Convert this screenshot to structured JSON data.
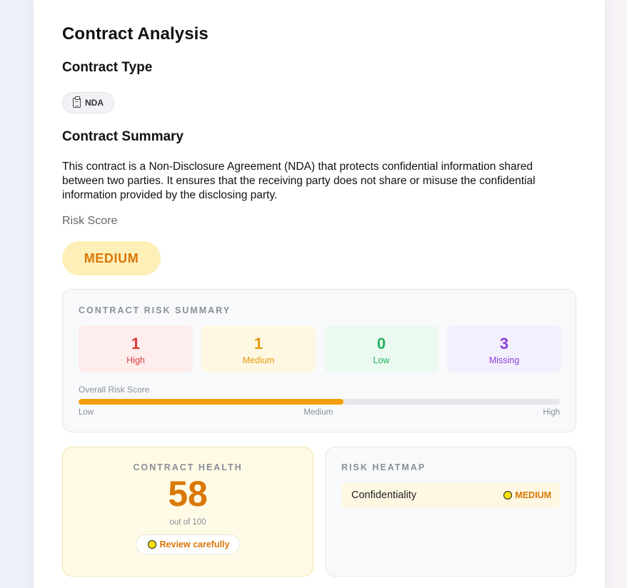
{
  "page": {
    "title": "Contract Analysis",
    "contract_type_heading": "Contract Type",
    "contract_type": "NDA",
    "summary_heading": "Contract Summary",
    "summary": "This contract is a Non-Disclosure Agreement (NDA) that protects confidential information shared between two parties. It ensures that the receiving party does not share or misuse the confidential information provided by the disclosing party.",
    "risk_score_label": "Risk Score",
    "risk_score": "MEDIUM"
  },
  "risk_summary": {
    "caption": "CONTRACT RISK SUMMARY",
    "stats": [
      {
        "value": "1",
        "label": "High"
      },
      {
        "value": "1",
        "label": "Medium"
      },
      {
        "value": "0",
        "label": "Low"
      },
      {
        "value": "3",
        "label": "Missing"
      }
    ],
    "overall_label": "Overall Risk Score",
    "overall_fraction": 0.55,
    "scale": [
      "Low",
      "Medium",
      "High"
    ]
  },
  "health": {
    "caption": "CONTRACT HEALTH",
    "score": "58",
    "out_of": "out of 100",
    "verdict": "Review carefully"
  },
  "heatmap": {
    "caption": "RISK HEATMAP",
    "rows": [
      {
        "name": "Confidentiality",
        "level": "MEDIUM"
      }
    ]
  },
  "colors": {
    "accent_medium": "#d97706",
    "high": "#dc3b3b",
    "low": "#22b35e",
    "missing": "#8a3fd8",
    "bar_fill": "#f59e0b"
  },
  "icons": {
    "contract_type": "clipboard-icon",
    "status_dot": "yellow-circle-icon"
  }
}
